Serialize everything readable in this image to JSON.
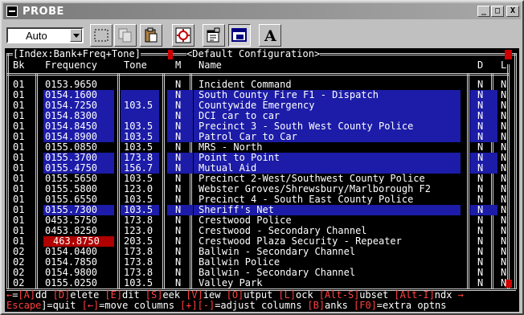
{
  "window": {
    "title": "PROBE",
    "buttons": {
      "minimize": "_",
      "maximize": "□",
      "close": "X"
    }
  },
  "toolbar": {
    "view_selected": "Auto",
    "tools": [
      {
        "name": "select-tool-button",
        "icon": "dotted-rectangle-icon"
      },
      {
        "name": "copy-tool-button",
        "icon": "copy-icon"
      },
      {
        "name": "paste-tool-button",
        "icon": "clipboard-icon"
      },
      {
        "name": "fullscreen-tool-button",
        "icon": "fullscreen-icon"
      },
      {
        "name": "properties-tool-button",
        "icon": "properties-icon"
      },
      {
        "name": "background-tool-button",
        "icon": "background-icon",
        "pressed": true
      },
      {
        "name": "font-tool-button",
        "icon": "font-a-icon",
        "label": "A"
      }
    ]
  },
  "console": {
    "header_index": "[Index:Bank+Freq+Tone]",
    "header_config": "<Default Configuration>",
    "columns": {
      "bank": "Bk",
      "frequency": "Frequency",
      "tone": "Tone",
      "m": "M",
      "name": "Name",
      "d": "D",
      "l": "L"
    },
    "rows": [
      {
        "bank": "01",
        "freq": "0153.9650",
        "tone": "",
        "m": "N",
        "name": "Incident Command",
        "d": "N",
        "l": "N",
        "hl": false
      },
      {
        "bank": "01",
        "freq": "0154.1600",
        "tone": "",
        "m": "N",
        "name": "South County Fire F1 - Dispatch",
        "d": "N",
        "l": "N",
        "hl": true
      },
      {
        "bank": "01",
        "freq": "0154.7250",
        "tone": "103.5",
        "m": "N",
        "name": "Countywide Emergency",
        "d": "N",
        "l": "N",
        "hl": true
      },
      {
        "bank": "01",
        "freq": "0154.8300",
        "tone": "",
        "m": "N",
        "name": "DCI car to car",
        "d": "N",
        "l": "N",
        "hl": true
      },
      {
        "bank": "01",
        "freq": "0154.8450",
        "tone": "103.5",
        "m": "N",
        "name": "Precinct 3 - South West County Police",
        "d": "N",
        "l": "N",
        "hl": true
      },
      {
        "bank": "01",
        "freq": "0154.8900",
        "tone": "103.5",
        "m": "N",
        "name": "Patrol Car to Car",
        "d": "N",
        "l": "N",
        "hl": true
      },
      {
        "bank": "01",
        "freq": "0155.0850",
        "tone": "103.5",
        "m": "N",
        "name": "MRS - North",
        "d": "N",
        "l": "N",
        "hl": false
      },
      {
        "bank": "01",
        "freq": "0155.3700",
        "tone": "173.8",
        "m": "N",
        "name": "Point to Point",
        "d": "N",
        "l": "N",
        "hl": true
      },
      {
        "bank": "01",
        "freq": "0155.4750",
        "tone": "156.7",
        "m": "N",
        "name": "Mutual Aid",
        "d": "N",
        "l": "N",
        "hl": true
      },
      {
        "bank": "01",
        "freq": "0155.5650",
        "tone": "103.5",
        "m": "N",
        "name": "Precinct 2-West/Southwest County Police",
        "d": "N",
        "l": "N",
        "hl": false
      },
      {
        "bank": "01",
        "freq": "0155.5800",
        "tone": "123.0",
        "m": "N",
        "name": "Webster Groves/Shrewsbury/Marlborough F2",
        "d": "N",
        "l": "N",
        "hl": false
      },
      {
        "bank": "01",
        "freq": "0155.6550",
        "tone": "103.5",
        "m": "N",
        "name": "Precinct 4 - South East County Police",
        "d": "N",
        "l": "N",
        "hl": false
      },
      {
        "bank": "01",
        "freq": "0155.7300",
        "tone": "103.5",
        "m": "N",
        "name": "Sheriff's Net",
        "d": "N",
        "l": "N",
        "hl": true
      },
      {
        "bank": "01",
        "freq": "0453.5750",
        "tone": "173.8",
        "m": "N",
        "name": "Crestwood Police",
        "d": "N",
        "l": "N",
        "hl": false
      },
      {
        "bank": "01",
        "freq": "0453.8250",
        "tone": "123.0",
        "m": "N",
        "name": "Crestwood - Secondary Channel",
        "d": "N",
        "l": "N",
        "hl": false
      },
      {
        "bank": "01",
        "freq": "463.8750",
        "tone": "203.5",
        "m": "N",
        "name": "Crestwood Plaza Security - Repeater",
        "d": "N",
        "l": "N",
        "hl": false,
        "red": true
      },
      {
        "bank": "02",
        "freq": "0154.0400",
        "tone": "173.8",
        "m": "N",
        "name": "Ballwin - Secondary Channel",
        "d": "N",
        "l": "N",
        "hl": false
      },
      {
        "bank": "02",
        "freq": "0154.7850",
        "tone": "173.8",
        "m": "N",
        "name": "Ballwin Police",
        "d": "N",
        "l": "N",
        "hl": false
      },
      {
        "bank": "02",
        "freq": "0154.9800",
        "tone": "173.8",
        "m": "N",
        "name": "Ballwin - Secondary Channel",
        "d": "N",
        "l": "N",
        "hl": false
      },
      {
        "bank": "02",
        "freq": "0155.0250",
        "tone": "103.5",
        "m": "N",
        "name": "Valley Park",
        "d": "N",
        "l": "N",
        "hl": false
      }
    ],
    "footer1": [
      {
        "t": "←",
        "c": "r"
      },
      {
        "t": "=",
        "c": "w"
      },
      {
        "t": "[A]",
        "c": "r"
      },
      {
        "t": "dd ",
        "c": "w"
      },
      {
        "t": "[D]",
        "c": "r"
      },
      {
        "t": "elete ",
        "c": "w"
      },
      {
        "t": "[E]",
        "c": "r"
      },
      {
        "t": "dit ",
        "c": "w"
      },
      {
        "t": "[S]",
        "c": "r"
      },
      {
        "t": "eek ",
        "c": "w"
      },
      {
        "t": "[V]",
        "c": "r"
      },
      {
        "t": "iew ",
        "c": "w"
      },
      {
        "t": "[O]",
        "c": "r"
      },
      {
        "t": "utput ",
        "c": "w"
      },
      {
        "t": "[L]",
        "c": "r"
      },
      {
        "t": "ock ",
        "c": "w"
      },
      {
        "t": "[Alt-S]",
        "c": "r"
      },
      {
        "t": "ubset ",
        "c": "w"
      },
      {
        "t": "[Alt-I]",
        "c": "r"
      },
      {
        "t": "ndx ",
        "c": "w"
      },
      {
        "t": "→",
        "c": "r"
      }
    ],
    "footer2": [
      {
        "t": "Escape",
        "c": "r"
      },
      {
        "t": "]=quit ",
        "c": "w"
      },
      {
        "t": "[←]",
        "c": "r"
      },
      {
        "t": "=move columns ",
        "c": "w"
      },
      {
        "t": "[+]",
        "c": "r"
      },
      {
        "t": "[-]",
        "c": "r"
      },
      {
        "t": "=adjust columns ",
        "c": "w"
      },
      {
        "t": "[B]",
        "c": "r"
      },
      {
        "t": "anks ",
        "c": "w"
      },
      {
        "t": "[F0]",
        "c": "r"
      },
      {
        "t": "=extra optns",
        "c": "w"
      }
    ]
  }
}
